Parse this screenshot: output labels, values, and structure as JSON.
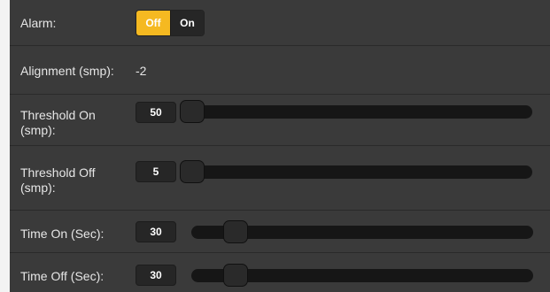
{
  "alarm": {
    "label": "Alarm:",
    "options": [
      "Off",
      "On"
    ],
    "selected": "Off",
    "accent_color": "#f5b921"
  },
  "alignment": {
    "label": "Alignment (smp):",
    "value": "-2"
  },
  "threshold_on": {
    "label_line1": "Threshold On",
    "label_line2": "(smp):",
    "value": "50",
    "slider_fraction": 0.0
  },
  "threshold_off": {
    "label_line1": "Threshold Off",
    "label_line2": "(smp):",
    "value": "5",
    "slider_fraction": 0.0
  },
  "time_on": {
    "label": "Time On (Sec):",
    "value": "30",
    "slider_fraction": 0.1
  },
  "time_off": {
    "label": "Time Off (Sec):",
    "value": "30",
    "slider_fraction": 0.1
  }
}
